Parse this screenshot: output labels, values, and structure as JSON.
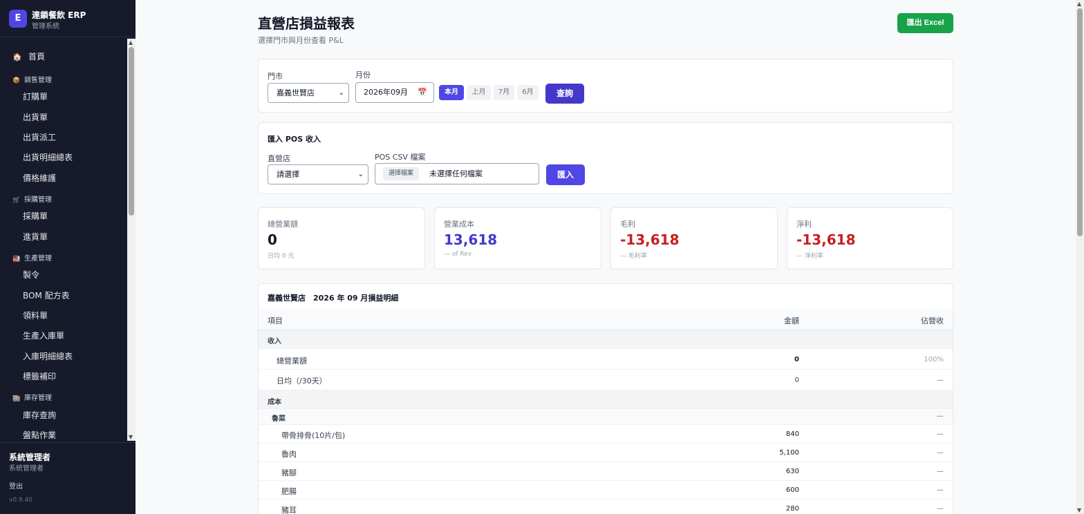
{
  "brand": {
    "logo": "E",
    "name": "連鎖餐飲 ERP",
    "sub": "管理系統"
  },
  "nav": {
    "home": {
      "icon": "🏠",
      "label": "首頁"
    },
    "groups": [
      {
        "icon": "📦",
        "label": "銷售管理",
        "items": [
          "訂購單",
          "出貨單",
          "出貨派工",
          "出貨明細總表",
          "價格維護"
        ]
      },
      {
        "icon": "🛒",
        "label": "採購管理",
        "items": [
          "採購單",
          "進貨單"
        ]
      },
      {
        "icon": "🏭",
        "label": "生產管理",
        "items": [
          "製令",
          "BOM 配方表",
          "領料單",
          "生產入庫單",
          "入庫明細總表",
          "標籤補印"
        ]
      },
      {
        "icon": "🏬",
        "label": "庫存管理",
        "items": [
          "庫存查詢",
          "盤點作業"
        ]
      }
    ]
  },
  "user": {
    "name": "系統管理者",
    "role": "系統管理者",
    "logout": "登出",
    "version": "v0.9.40"
  },
  "header": {
    "title": "直營店損益報表",
    "subtitle": "選擇門市與月份查看 P&L",
    "export_label": "匯出 Excel"
  },
  "filter": {
    "store_label": "門市",
    "store_value": "嘉義世賢店",
    "month_label": "月份",
    "month_value": "2026年09月",
    "chips": [
      "本月",
      "上月",
      "7月",
      "6月"
    ],
    "query_label": "查詢"
  },
  "pos_import": {
    "title": "匯入 POS 收入",
    "store_label": "直營店",
    "store_value": "請選擇",
    "file_label": "POS CSV 檔案",
    "file_button": "選擇檔案",
    "file_status": "未選擇任何檔案",
    "import_label": "匯入"
  },
  "kpis": [
    {
      "label": "總營業額",
      "value": "0",
      "note": "日均 0 元",
      "color": "#111827"
    },
    {
      "label": "營業成本",
      "value": "13,618",
      "note": "— of Rev",
      "color": "#4338ca"
    },
    {
      "label": "毛利",
      "value": "-13,618",
      "note": "— 毛利率",
      "color": "#c81e1e"
    },
    {
      "label": "淨利",
      "value": "-13,618",
      "note": "— 淨利率",
      "color": "#c81e1e"
    }
  ],
  "pl_table": {
    "title": "嘉義世賢店　2026 年 09 月損益明細",
    "headers": {
      "item": "項目",
      "amount": "金額",
      "ratio": "佔營收"
    },
    "revenue_section": "收入",
    "revenue_rows": [
      {
        "name": "總營業額",
        "amount": "0",
        "ratio": "100%"
      },
      {
        "name": "日均（/30天）",
        "amount": "0",
        "ratio": "—"
      }
    ],
    "cost_section": "成本",
    "cost_group": {
      "name": "魯菜",
      "ratio": "—"
    },
    "cost_rows": [
      {
        "name": "帶骨排骨(10片/包)",
        "amount": "840",
        "ratio": "—"
      },
      {
        "name": "魯肉",
        "amount": "5,100",
        "ratio": "—"
      },
      {
        "name": "豬腳",
        "amount": "630",
        "ratio": "—"
      },
      {
        "name": "肥腸",
        "amount": "600",
        "ratio": "—"
      },
      {
        "name": "豬耳",
        "amount": "280",
        "ratio": "—"
      }
    ]
  }
}
